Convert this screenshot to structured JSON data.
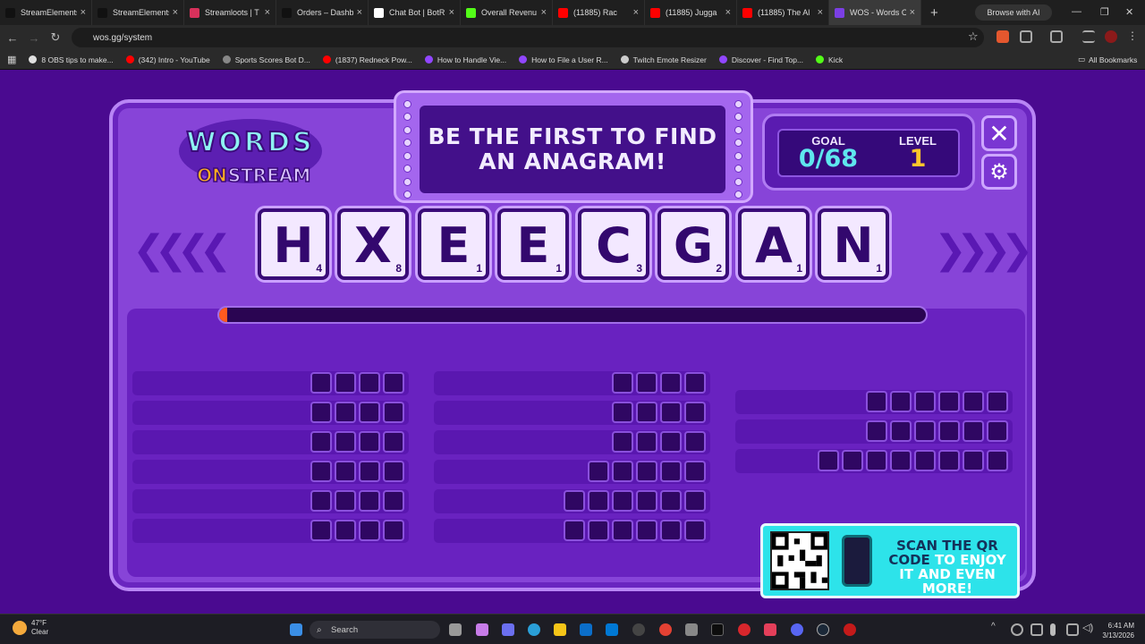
{
  "browser": {
    "tabs": [
      {
        "label": "StreamElements",
        "color": "#111111",
        "active": false
      },
      {
        "label": "StreamElements",
        "color": "#111111",
        "active": false
      },
      {
        "label": "Streamloots | T",
        "color": "#d8315b",
        "active": false
      },
      {
        "label": "Orders – Dashb",
        "color": "#111111",
        "active": false
      },
      {
        "label": "Chat Bot | BotR",
        "color": "#ffffff",
        "active": false
      },
      {
        "label": "Overall Revenu",
        "color": "#53fc18",
        "active": false
      },
      {
        "label": "(11885) Rac",
        "color": "#ff0000",
        "active": false
      },
      {
        "label": "(11885) Jugga",
        "color": "#ff0000",
        "active": false
      },
      {
        "label": "(11885) The Al",
        "color": "#ff0000",
        "active": false
      },
      {
        "label": "WOS - Words O",
        "color": "#7b3fe4",
        "active": true
      }
    ],
    "browse_ai": "Browse with AI",
    "url": "wos.gg/system",
    "bookmarks": [
      {
        "label": "8 OBS tips to make...",
        "color": "#e0e0e0"
      },
      {
        "label": "(342) Intro - YouTube",
        "color": "#ff0000"
      },
      {
        "label": "Sports Scores Bot D...",
        "color": "#888888"
      },
      {
        "label": "(1837) Redneck Pow...",
        "color": "#ff0000"
      },
      {
        "label": "How to Handle Vie...",
        "color": "#9146ff"
      },
      {
        "label": "How to File a User R...",
        "color": "#9146ff"
      },
      {
        "label": "Twitch Emote Resizer",
        "color": "#cccccc"
      },
      {
        "label": "Discover - Find Top...",
        "color": "#9146ff"
      },
      {
        "label": "Kick",
        "color": "#53fc18"
      }
    ],
    "all_bookmarks": "All Bookmarks"
  },
  "game": {
    "logo": {
      "line1": "WORDS",
      "line2": "ON",
      "line3": "STREAM"
    },
    "prompt_line1": "BE THE FIRST TO FIND",
    "prompt_line2": "AN ANAGRAM!",
    "goal_label": "GOAL",
    "goal_value": "0/68",
    "level_label": "LEVEL",
    "level_value": "1",
    "progress": 0.01,
    "tiles": [
      {
        "letter": "H",
        "points": "4"
      },
      {
        "letter": "X",
        "points": "8"
      },
      {
        "letter": "E",
        "points": "1"
      },
      {
        "letter": "E",
        "points": "1"
      },
      {
        "letter": "C",
        "points": "3"
      },
      {
        "letter": "G",
        "points": "2"
      },
      {
        "letter": "A",
        "points": "1"
      },
      {
        "letter": "N",
        "points": "1"
      }
    ],
    "word_columns": [
      [
        4,
        4,
        4,
        4,
        4,
        4
      ],
      [
        4,
        4,
        4,
        5,
        6,
        6
      ],
      [
        6,
        6,
        8
      ]
    ],
    "qr_text_a": "SCAN THE QR CODE",
    "qr_text_b": "TO ENJOY IT AND EVEN MORE!"
  },
  "taskbar": {
    "temp": "47°F",
    "condition": "Clear",
    "search": "Search",
    "time": "6:41 AM",
    "date": "3/13/2026"
  }
}
